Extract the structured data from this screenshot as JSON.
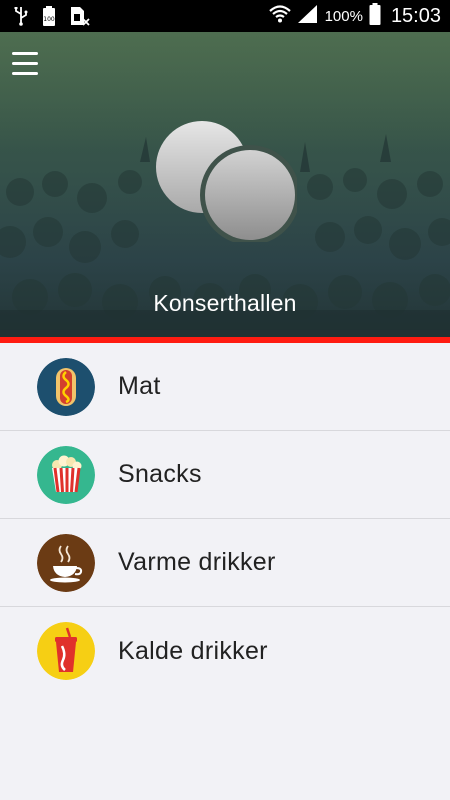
{
  "status_bar": {
    "battery_percent": "100%",
    "time": "15:03",
    "icons": [
      "usb-icon",
      "battery-full-icon",
      "sim-card-icon",
      "wifi-icon",
      "signal-icon",
      "battery-icon"
    ]
  },
  "header": {
    "venue_name": "Konserthallen",
    "menu_icon": "hamburger-menu-icon",
    "logo": "venue-logo",
    "accent_color": "#ff1c12"
  },
  "categories": [
    {
      "label": "Mat",
      "icon": "hotdog-icon",
      "color": "#1d4f6e"
    },
    {
      "label": "Snacks",
      "icon": "popcorn-icon",
      "color": "#35b78f"
    },
    {
      "label": "Varme drikker",
      "icon": "hot-drink-icon",
      "color": "#6b3b14"
    },
    {
      "label": "Kalde drikker",
      "icon": "cold-drink-icon",
      "color": "#f6cf14"
    }
  ]
}
